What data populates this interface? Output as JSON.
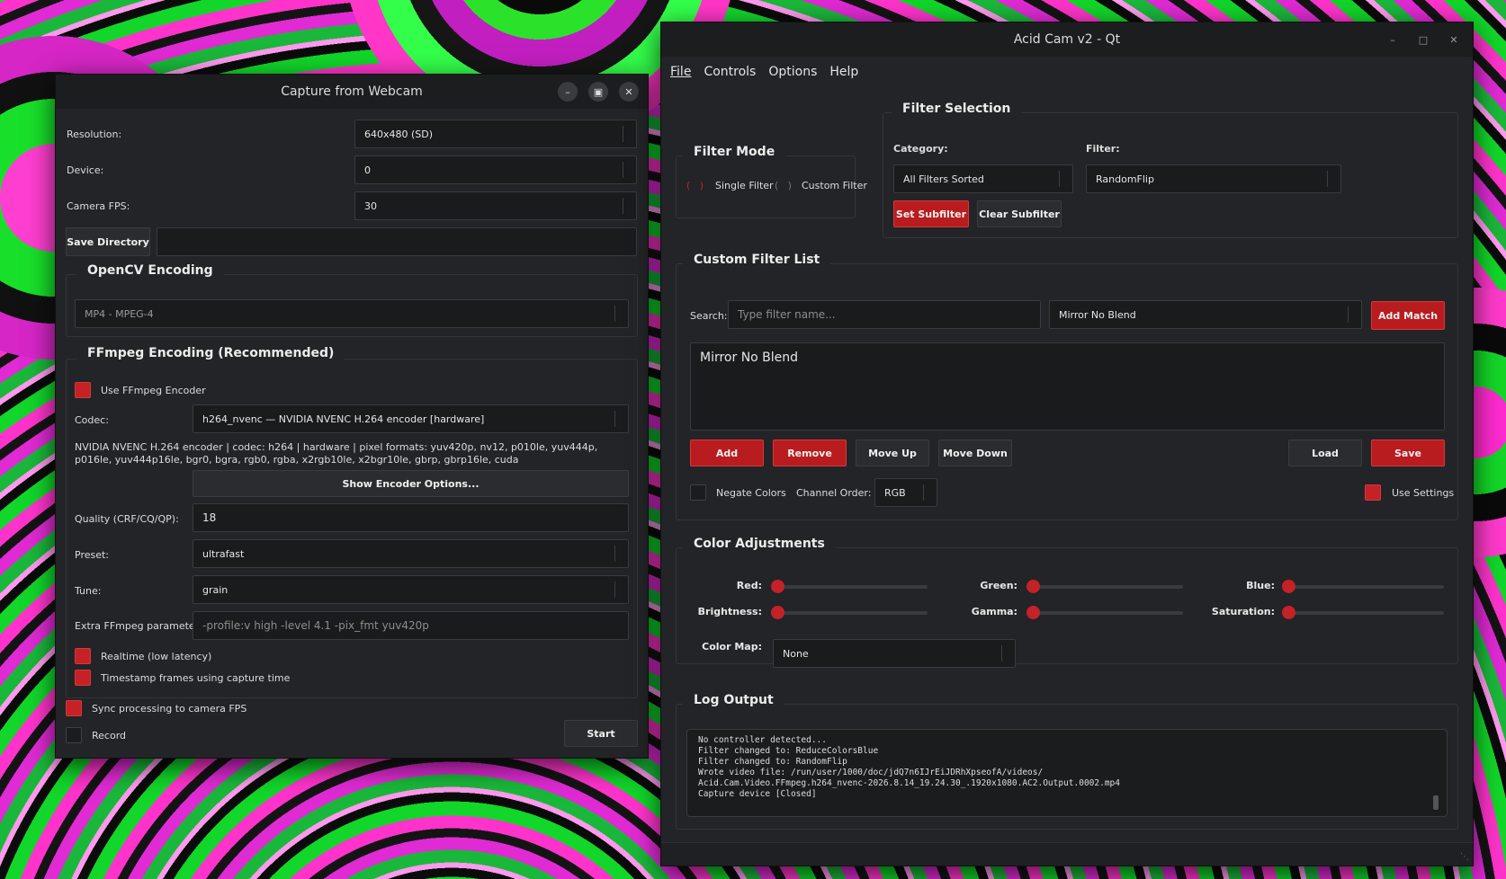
{
  "webcam": {
    "title": "Capture from Webcam",
    "resolution_label": "Resolution:",
    "resolution_value": "640x480 (SD)",
    "device_label": "Device:",
    "device_value": "0",
    "fps_label": "Camera FPS:",
    "fps_value": "30",
    "save_dir_button": "Save Directory",
    "save_dir_value": "",
    "opencv_title": "OpenCV Encoding",
    "opencv_codec": "MP4 - MPEG-4",
    "ffmpeg_title": "FFmpeg Encoding (Recommended)",
    "use_ffmpeg_label": "Use FFmpeg Encoder",
    "codec_label": "Codec:",
    "codec_value": "h264_nvenc — NVIDIA NVENC H.264 encoder [hardware]",
    "codec_info": "NVIDIA NVENC H.264 encoder | codec: h264 | hardware | pixel formats: yuv420p, nv12, p010le, yuv444p, p016le, yuv444p16le, bgr0, bgra, rgb0, rgba, x2rgb10le, x2bgr10le, gbrp, gbrp16le, cuda",
    "show_encoder_options": "Show Encoder Options...",
    "quality_label": "Quality (CRF/CQ/QP):",
    "quality_value": "18",
    "preset_label": "Preset:",
    "preset_value": "ultrafast",
    "tune_label": "Tune:",
    "tune_value": "grain",
    "extra_label": "Extra FFmpeg parameters:",
    "extra_placeholder": "-profile:v high -level 4.1 -pix_fmt yuv420p",
    "realtime_label": "Realtime (low latency)",
    "timestamp_label": "Timestamp frames using capture time",
    "sync_label": "Sync processing to camera FPS",
    "record_label": "Record",
    "start_button": "Start"
  },
  "acid": {
    "title": "Acid Cam v2 - Qt",
    "menu": [
      "File",
      "Controls",
      "Options",
      "Help"
    ],
    "filter_mode_title": "Filter Mode",
    "single_filter": "Single Filter",
    "custom_filter": "Custom Filter",
    "filter_selection_title": "Filter Selection",
    "category_label": "Category:",
    "category_value": "All Filters Sorted",
    "filter_label": "Filter:",
    "filter_value": "RandomFlip",
    "set_subfilter": "Set Subfilter",
    "clear_subfilter": "Clear Subfilter",
    "custom_list_title": "Custom Filter List",
    "search_label": "Search:",
    "search_placeholder": "Type filter name...",
    "match_value": "Mirror No Blend",
    "add_match": "Add Match",
    "list_items": [
      "Mirror No Blend"
    ],
    "add": "Add",
    "remove": "Remove",
    "move_up": "Move Up",
    "move_down": "Move Down",
    "load": "Load",
    "save": "Save",
    "negate_label": "Negate Colors",
    "channel_label": "Channel Order:",
    "channel_value": "RGB",
    "use_settings": "Use Settings",
    "color_title": "Color Adjustments",
    "red": "Red:",
    "green": "Green:",
    "blue": "Blue:",
    "brightness": "Brightness:",
    "gamma": "Gamma:",
    "saturation": "Saturation:",
    "colormap_label": "Color Map:",
    "colormap_value": "None",
    "log_title": "Log Output",
    "log_text": "No controller detected...\nFilter changed to: ReduceColorsBlue\nFilter changed to: RandomFlip\nWrote video file: /run/user/1000/doc/jdQ7n6IJrEiJDRhXpseofA/videos/\nAcid.Cam.Video.FFmpeg.h264_nvenc-2026.8.14_19.24.30_.1920x1080.AC2.Output.0002.mp4\nCapture device [Closed]"
  }
}
